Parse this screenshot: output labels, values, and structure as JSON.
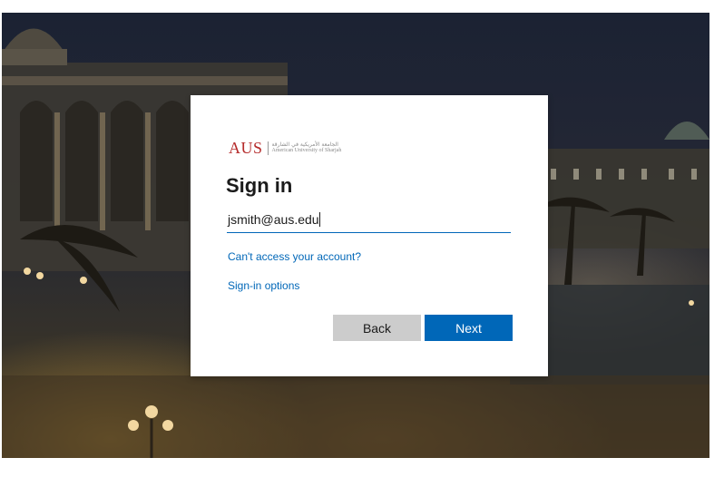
{
  "logo": {
    "mark": "AUS",
    "arabic_name": "الجامعة الأمريكية في الشارقة",
    "english_name": "American University of Sharjah"
  },
  "signin": {
    "title": "Sign in",
    "email_value": "jsmith@aus.edu",
    "cant_access_link": "Can't access your account?",
    "options_link": "Sign-in options",
    "back_label": "Back",
    "next_label": "Next"
  },
  "colors": {
    "accent": "#0067b8",
    "brand_red": "#b52b2b",
    "back_button": "#cccccc"
  }
}
